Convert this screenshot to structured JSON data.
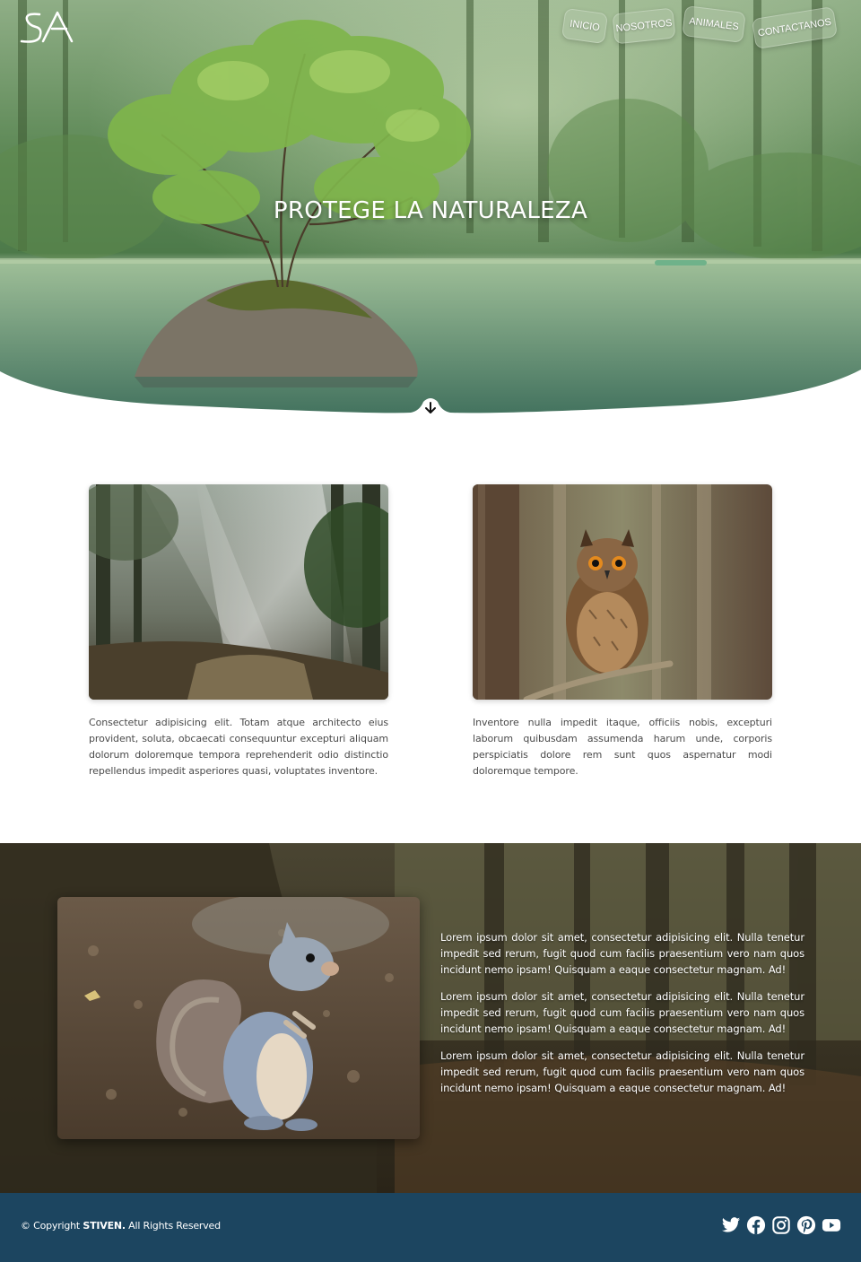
{
  "header": {
    "logo_text": "SA",
    "nav": [
      {
        "label": "INICIO"
      },
      {
        "label": "NOSOTROS"
      },
      {
        "label": "ANIMALES"
      },
      {
        "label": "CONTACTANOS"
      }
    ]
  },
  "hero": {
    "title": "PROTEGE LA NATURALEZA",
    "scroll_icon": "arrow-down-icon"
  },
  "cards": [
    {
      "image": "forest-sunlight-image",
      "text": "Consectetur adipisicing elit. Totam atque architecto eius provident, soluta, obcaecati consequuntur excepturi aliquam dolorum doloremque tempora reprehenderit odio distinctio repellendus impedit asperiores quasi, voluptates inventore."
    },
    {
      "image": "owl-image",
      "text": "Inventore nulla impedit itaque, officiis nobis, excepturi laborum quibusdam assumenda harum unde, corporis perspiciatis dolore rem sunt quos aspernatur modi doloremque tempore."
    }
  ],
  "feature": {
    "image": "squirrel-image",
    "paragraphs": [
      "Lorem ipsum dolor sit amet, consectetur adipisicing elit. Nulla tenetur impedit sed rerum, fugit quod cum facilis praesentium vero nam quos incidunt nemo ipsam! Quisquam a eaque consectetur magnam. Ad!",
      "Lorem ipsum dolor sit amet, consectetur adipisicing elit. Nulla tenetur impedit sed rerum, fugit quod cum facilis praesentium vero nam quos incidunt nemo ipsam! Quisquam a eaque consectetur magnam. Ad!",
      "Lorem ipsum dolor sit amet, consectetur adipisicing elit. Nulla tenetur impedit sed rerum, fugit quod cum facilis praesentium vero nam quos incidunt nemo ipsam! Quisquam a eaque consectetur magnam. Ad!"
    ]
  },
  "footer": {
    "copyright_prefix": "© Copyright ",
    "brand": "STIVEN.",
    "copyright_suffix": " All Rights Reserved",
    "social": [
      "twitter-icon",
      "facebook-icon",
      "instagram-icon",
      "pinterest-icon",
      "youtube-icon"
    ],
    "background": "#1c4560"
  },
  "colors": {
    "footer_bg": "#1c4560",
    "nav_button_bg": "rgba(180,200,170,0.45)"
  }
}
